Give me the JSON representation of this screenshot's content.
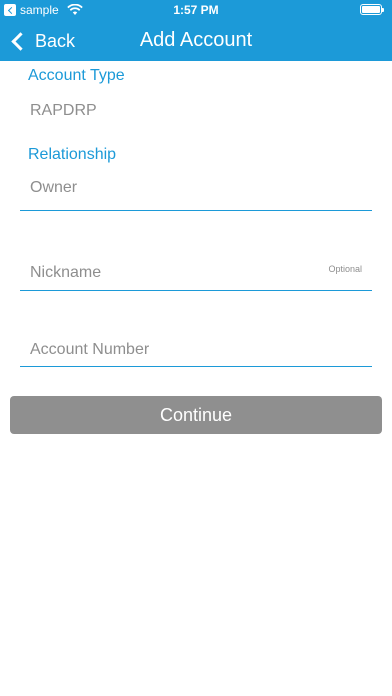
{
  "status_bar": {
    "back_app_label": "sample",
    "time": "1:57 PM"
  },
  "nav": {
    "back_label": "Back",
    "title": "Add Account"
  },
  "form": {
    "account_type": {
      "label": "Account Type",
      "value": "RAPDRP"
    },
    "relationship": {
      "label": "Relationship",
      "value": "Owner"
    },
    "nickname": {
      "placeholder": "Nickname",
      "optional_label": "Optional"
    },
    "account_number": {
      "placeholder": "Account Number"
    }
  },
  "continue_label": "Continue",
  "colors": {
    "accent": "#1c9ad8",
    "button_disabled": "#8f8f8f",
    "placeholder_text": "#8e8e8e"
  }
}
